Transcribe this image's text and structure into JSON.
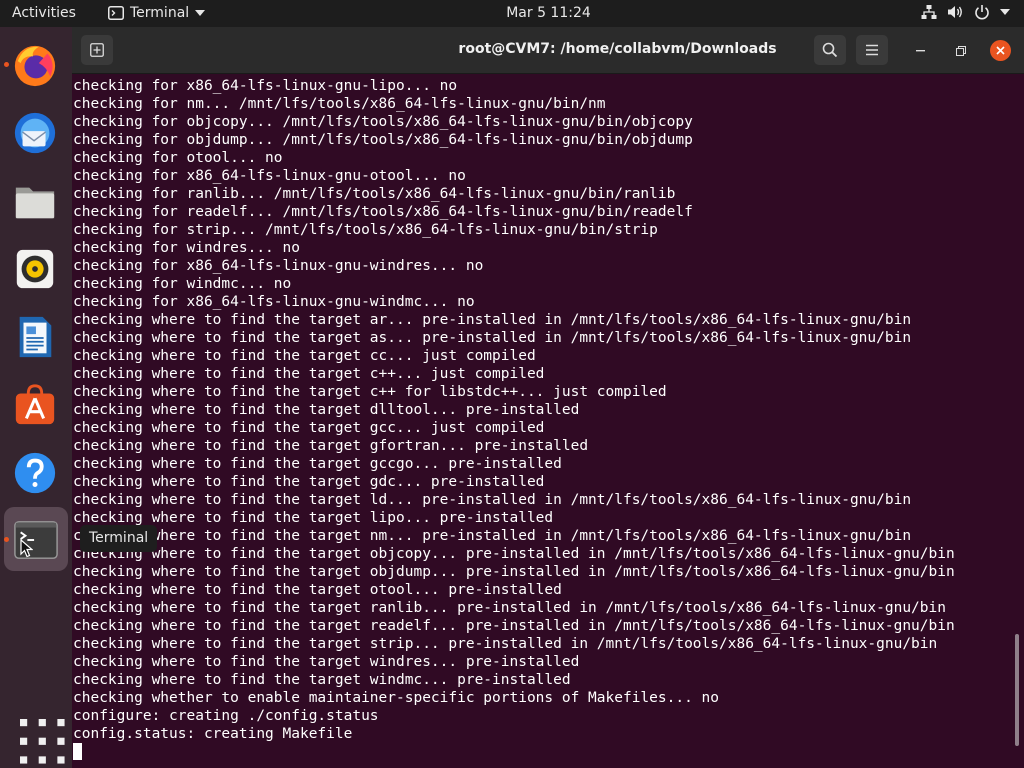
{
  "topbar": {
    "activities": "Activities",
    "app_name": "Terminal",
    "clock": "Mar 5  11:24"
  },
  "dock": {
    "items": [
      {
        "name": "firefox",
        "running": true
      },
      {
        "name": "thunderbird",
        "running": false
      },
      {
        "name": "files",
        "running": false
      },
      {
        "name": "rhythmbox",
        "running": false
      },
      {
        "name": "libreoffice-writer",
        "running": false
      },
      {
        "name": "ubuntu-software",
        "running": false
      },
      {
        "name": "help",
        "running": false
      },
      {
        "name": "terminal",
        "running": true
      }
    ],
    "tooltip": "Terminal"
  },
  "window": {
    "title": "root@CVM7: /home/collabvm/Downloads"
  },
  "terminal": {
    "lines": [
      "checking for x86_64-lfs-linux-gnu-lipo... no",
      "checking for nm... /mnt/lfs/tools/x86_64-lfs-linux-gnu/bin/nm",
      "checking for objcopy... /mnt/lfs/tools/x86_64-lfs-linux-gnu/bin/objcopy",
      "checking for objdump... /mnt/lfs/tools/x86_64-lfs-linux-gnu/bin/objdump",
      "checking for otool... no",
      "checking for x86_64-lfs-linux-gnu-otool... no",
      "checking for ranlib... /mnt/lfs/tools/x86_64-lfs-linux-gnu/bin/ranlib",
      "checking for readelf... /mnt/lfs/tools/x86_64-lfs-linux-gnu/bin/readelf",
      "checking for strip... /mnt/lfs/tools/x86_64-lfs-linux-gnu/bin/strip",
      "checking for windres... no",
      "checking for x86_64-lfs-linux-gnu-windres... no",
      "checking for windmc... no",
      "checking for x86_64-lfs-linux-gnu-windmc... no",
      "checking where to find the target ar... pre-installed in /mnt/lfs/tools/x86_64-lfs-linux-gnu/bin",
      "checking where to find the target as... pre-installed in /mnt/lfs/tools/x86_64-lfs-linux-gnu/bin",
      "checking where to find the target cc... just compiled",
      "checking where to find the target c++... just compiled",
      "checking where to find the target c++ for libstdc++... just compiled",
      "checking where to find the target dlltool... pre-installed",
      "checking where to find the target gcc... just compiled",
      "checking where to find the target gfortran... pre-installed",
      "checking where to find the target gccgo... pre-installed",
      "checking where to find the target gdc... pre-installed",
      "checking where to find the target ld... pre-installed in /mnt/lfs/tools/x86_64-lfs-linux-gnu/bin",
      "checking where to find the target lipo... pre-installed",
      "checking where to find the target nm... pre-installed in /mnt/lfs/tools/x86_64-lfs-linux-gnu/bin",
      "checking where to find the target objcopy... pre-installed in /mnt/lfs/tools/x86_64-lfs-linux-gnu/bin",
      "checking where to find the target objdump... pre-installed in /mnt/lfs/tools/x86_64-lfs-linux-gnu/bin",
      "checking where to find the target otool... pre-installed",
      "checking where to find the target ranlib... pre-installed in /mnt/lfs/tools/x86_64-lfs-linux-gnu/bin",
      "checking where to find the target readelf... pre-installed in /mnt/lfs/tools/x86_64-lfs-linux-gnu/bin",
      "checking where to find the target strip... pre-installed in /mnt/lfs/tools/x86_64-lfs-linux-gnu/bin",
      "checking where to find the target windres... pre-installed",
      "checking where to find the target windmc... pre-installed",
      "checking whether to enable maintainer-specific portions of Makefiles... no",
      "configure: creating ./config.status",
      "config.status: creating Makefile"
    ]
  },
  "colors": {
    "terminal_bg": "#300a24",
    "accent": "#e95420",
    "titlebar_bg": "#2b2b2b",
    "topbar_bg": "#1d1d1d"
  }
}
